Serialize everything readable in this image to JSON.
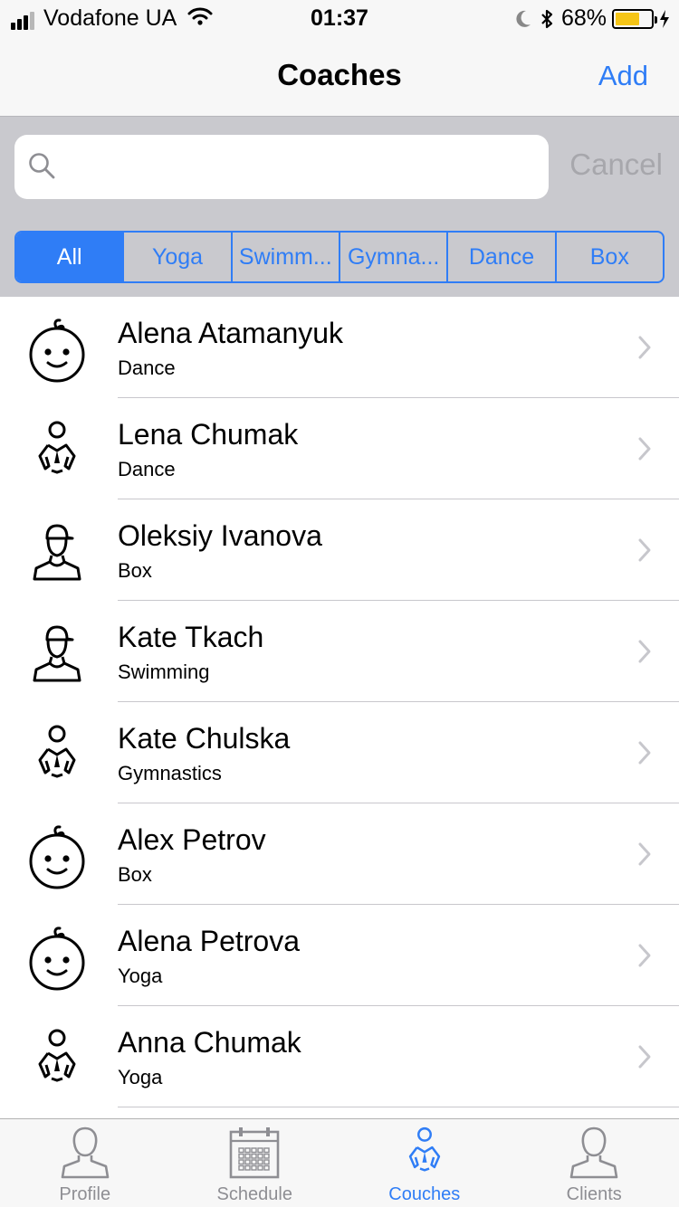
{
  "status_bar": {
    "carrier": "Vodafone UA",
    "time": "01:37",
    "battery": "68%",
    "battery_level": 0.68
  },
  "nav": {
    "title": "Coaches",
    "add_label": "Add"
  },
  "search": {
    "placeholder": "",
    "cancel_label": "Cancel"
  },
  "segments": [
    {
      "label": "All",
      "active": true
    },
    {
      "label": "Yoga",
      "active": false
    },
    {
      "label": "Swimm...",
      "active": false
    },
    {
      "label": "Gymna...",
      "active": false
    },
    {
      "label": "Dance",
      "active": false
    },
    {
      "label": "Box",
      "active": false
    }
  ],
  "coaches": [
    {
      "name": "Alena Atamanyuk",
      "sport": "Dance",
      "avatar": "baby-face-icon"
    },
    {
      "name": "Lena Chumak",
      "sport": "Dance",
      "avatar": "coach-whistle-icon"
    },
    {
      "name": "Oleksiy Ivanova",
      "sport": "Box",
      "avatar": "person-cap-icon"
    },
    {
      "name": "Kate Tkach",
      "sport": "Swimming",
      "avatar": "person-cap-icon"
    },
    {
      "name": "Kate Chulska",
      "sport": "Gymnastics",
      "avatar": "coach-whistle-icon"
    },
    {
      "name": "Alex Petrov",
      "sport": "Box",
      "avatar": "baby-face-icon"
    },
    {
      "name": "Alena Petrova",
      "sport": "Yoga",
      "avatar": "baby-face-icon"
    },
    {
      "name": "Anna Chumak",
      "sport": "Yoga",
      "avatar": "coach-whistle-icon"
    }
  ],
  "tabs": [
    {
      "label": "Profile",
      "icon": "person-icon",
      "active": false
    },
    {
      "label": "Schedule",
      "icon": "calendar-icon",
      "active": false
    },
    {
      "label": "Couches",
      "icon": "coach-whistle-icon",
      "active": true
    },
    {
      "label": "Clients",
      "icon": "person-icon",
      "active": false
    }
  ],
  "colors": {
    "accent": "#2f7df6",
    "search_background": "#c9c9ce",
    "bar_background": "#f7f7f7",
    "battery": "#f5c518",
    "inactive_tab": "#8e8e93"
  }
}
